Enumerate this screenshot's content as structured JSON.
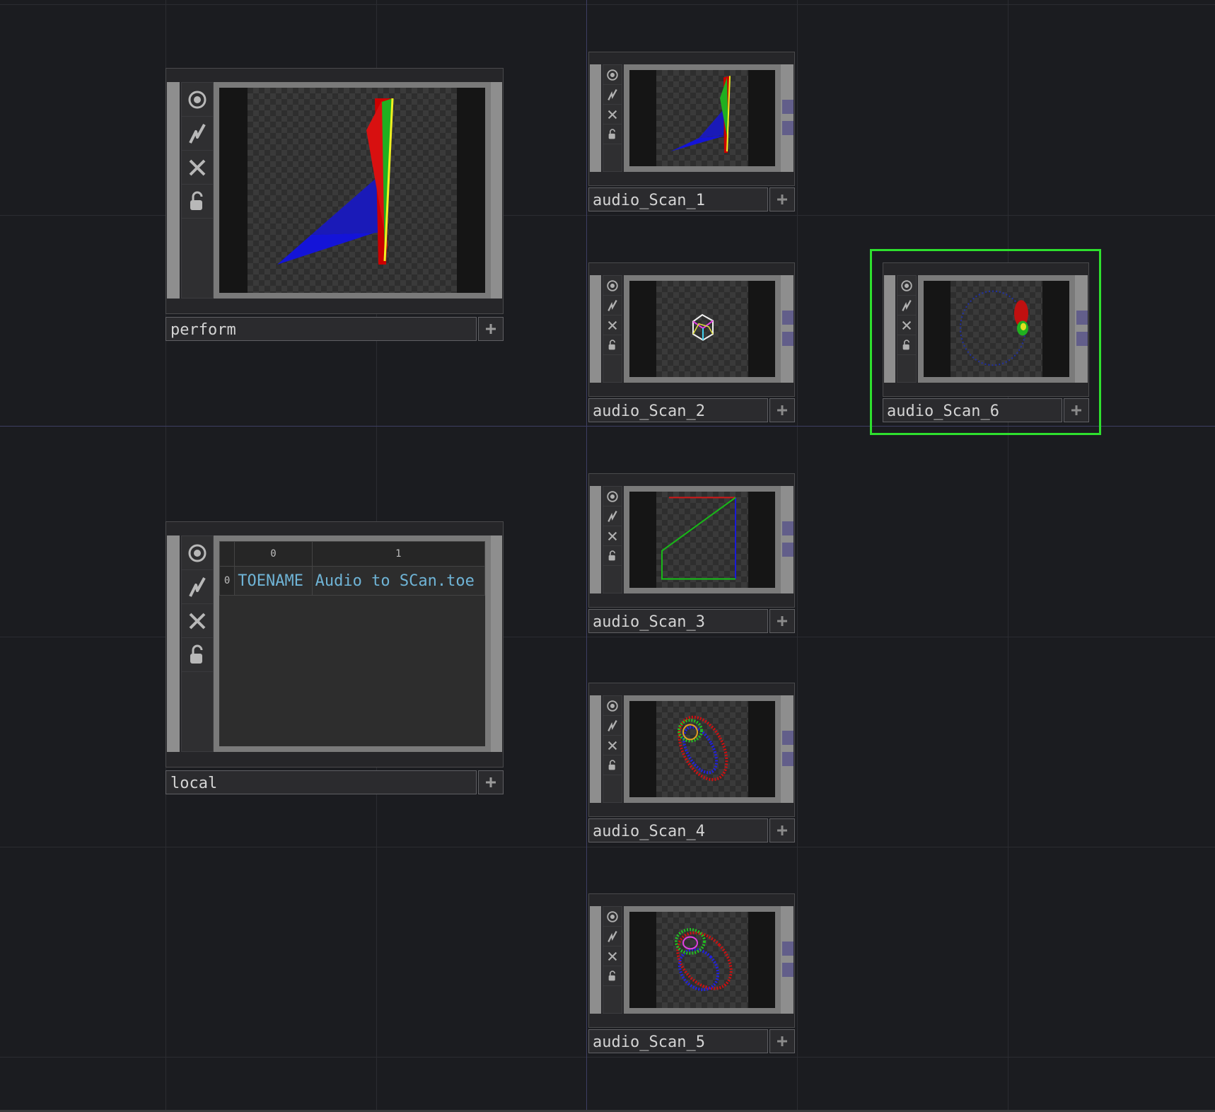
{
  "network": {
    "nodes": [
      {
        "name": "perform",
        "type": "TOP",
        "selected": false,
        "preview": "spike"
      },
      {
        "name": "audio_Scan_1",
        "type": "TOP",
        "selected": false,
        "preview": "spike"
      },
      {
        "name": "audio_Scan_2",
        "type": "TOP",
        "selected": false,
        "preview": "cube"
      },
      {
        "name": "audio_Scan_3",
        "type": "TOP",
        "selected": false,
        "preview": "quad"
      },
      {
        "name": "audio_Scan_4",
        "type": "TOP",
        "selected": false,
        "preview": "ring"
      },
      {
        "name": "audio_Scan_5",
        "type": "TOP",
        "selected": false,
        "preview": "ring"
      },
      {
        "name": "audio_Scan_6",
        "type": "TOP",
        "selected": true,
        "preview": "circle"
      },
      {
        "name": "local",
        "type": "DAT",
        "selected": false,
        "preview": "table"
      }
    ],
    "local_table": {
      "col_headers": [
        "0",
        "1"
      ],
      "rows": [
        {
          "index": "0",
          "cells": [
            "TOENAME",
            "Audio to SCan.toe"
          ]
        }
      ]
    },
    "flag_icons": [
      "viewer-active-icon",
      "bypass-icon",
      "cook-off-icon",
      "lock-icon"
    ],
    "colors": {
      "background": "#1b1c20",
      "selection": "#2ee02e",
      "connector": "#625e8a",
      "table_text": "#6fb4d6"
    }
  }
}
